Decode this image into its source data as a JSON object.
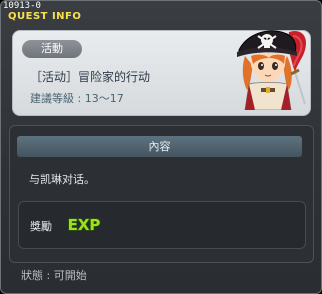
{
  "window": {
    "quest_id": "10913-0",
    "title": "QUEST INFO"
  },
  "quest": {
    "badge": "活動",
    "name": "［活动］冒险家的行动",
    "level": "建議等級 : 13～17"
  },
  "content": {
    "header": "內容",
    "text": "与凯琳对话。"
  },
  "reward": {
    "label": "獎勵",
    "exp_label": "EXP"
  },
  "status": {
    "text": "狀態 : 可開始"
  },
  "icons": {
    "npc": "pirate-captain-portrait-icon",
    "exp": "exp-icon"
  },
  "colors": {
    "title": "#f7e24a",
    "exp": "#9be21c"
  }
}
